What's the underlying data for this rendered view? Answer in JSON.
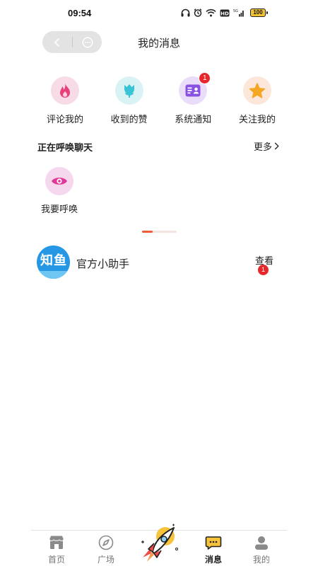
{
  "status_bar": {
    "time": "09:54",
    "battery": "100",
    "icons": [
      "headphones-icon",
      "alarm-icon",
      "wifi-icon",
      "hd-icon",
      "signal-icon",
      "battery-icon"
    ]
  },
  "header": {
    "title": "我的消息",
    "back_icon": "chevron-left-icon",
    "more_icon": "more-circle-icon"
  },
  "categories": [
    {
      "label": "评论我的",
      "icon": "flame-icon",
      "color": "#e8417a",
      "bg": "#f7dbe6"
    },
    {
      "label": "收到的赞",
      "icon": "tulip-icon",
      "color": "#38c3d6",
      "bg": "#d9f3f5"
    },
    {
      "label": "系统通知",
      "icon": "id-card-icon",
      "color": "#8a52e0",
      "bg": "#e9ddfa",
      "badge": "1"
    },
    {
      "label": "关注我的",
      "icon": "star-icon",
      "color": "#f5a623",
      "bg": "#fde7da"
    }
  ],
  "calling_section": {
    "title": "正在呼唤聊天",
    "more": "更多",
    "item": {
      "label": "我要呼唤",
      "icon": "eye-icon",
      "color": "#e0389a"
    }
  },
  "messages": [
    {
      "name": "官方小助手",
      "avatar_text": "知鱼",
      "action": "查看",
      "badge": "1"
    }
  ],
  "tabbar": {
    "tabs": [
      {
        "label": "首页",
        "icon": "shop-icon",
        "active": false
      },
      {
        "label": "广场",
        "icon": "compass-icon",
        "active": false
      },
      {
        "label": "消息",
        "icon": "chat-icon",
        "active": true
      },
      {
        "label": "我的",
        "icon": "user-icon",
        "active": false
      }
    ],
    "center_icon": "rocket-icon"
  },
  "colors": {
    "accent": "#ef5a38",
    "badge": "#e8272b",
    "avatar": "#2597e4"
  }
}
